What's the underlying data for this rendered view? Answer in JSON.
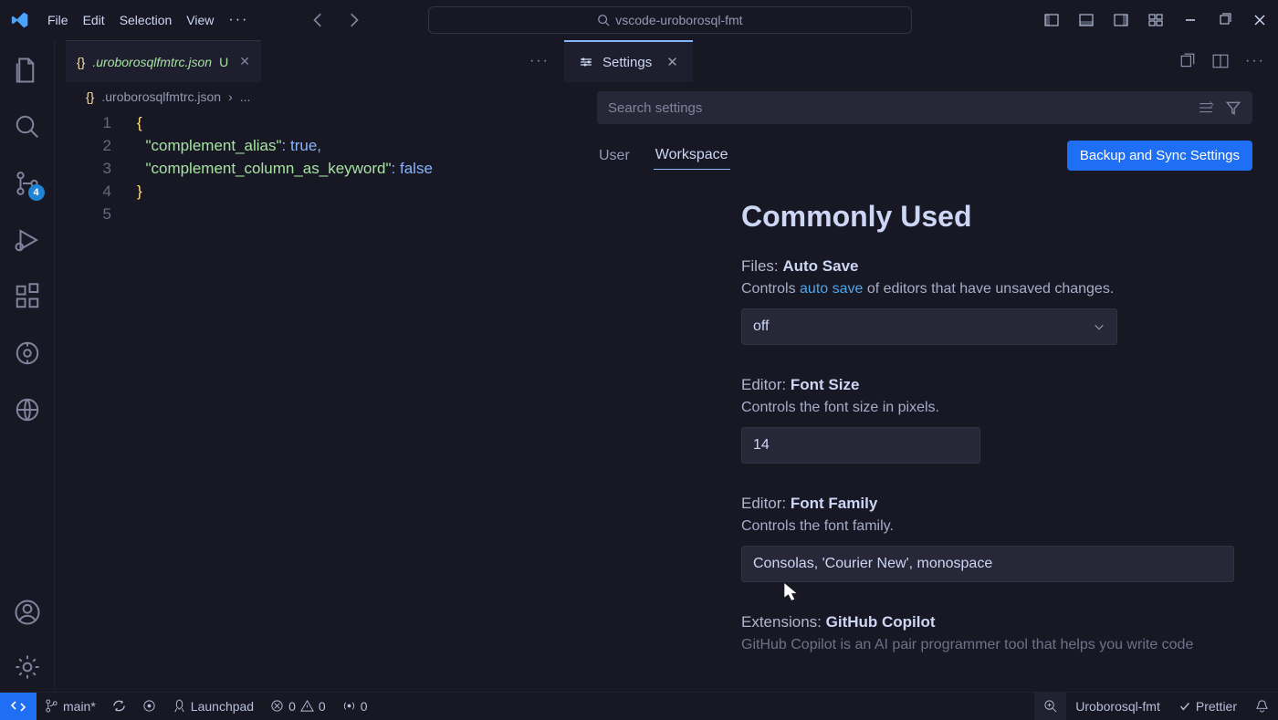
{
  "titlebar": {
    "menu": [
      "File",
      "Edit",
      "Selection",
      "View"
    ],
    "search": "vscode-uroborosql-fmt"
  },
  "activity": {
    "scm_badge": "4"
  },
  "editor_left": {
    "tab": {
      "filename": ".uroborosqlfmtrc.json",
      "dirty": "U"
    },
    "breadcrumb": ".uroborosqlfmtrc.json",
    "breadcrumb_tail": "...",
    "code": {
      "l1": "{",
      "l2_key": "\"complement_alias\"",
      "l2_val": "true",
      "l3_key": "\"complement_column_as_keyword\"",
      "l3_val": "false",
      "l4": "}"
    },
    "line_nums": [
      "1",
      "2",
      "3",
      "4",
      "5"
    ]
  },
  "settings": {
    "tab_label": "Settings",
    "search_placeholder": "Search settings",
    "scopes": {
      "user": "User",
      "workspace": "Workspace"
    },
    "sync_button": "Backup and Sync Settings",
    "section": "Commonly Used",
    "items": [
      {
        "cat": "Files:",
        "name": "Auto Save",
        "desc_pre": "Controls ",
        "desc_link": "auto save",
        "desc_post": " of editors that have unsaved changes.",
        "value": "off",
        "type": "select"
      },
      {
        "cat": "Editor:",
        "name": "Font Size",
        "desc": "Controls the font size in pixels.",
        "value": "14",
        "type": "input-sm"
      },
      {
        "cat": "Editor:",
        "name": "Font Family",
        "desc": "Controls the font family.",
        "value": "Consolas, 'Courier New', monospace",
        "type": "input-lg"
      },
      {
        "cat": "Extensions:",
        "name": "GitHub Copilot",
        "desc": "GitHub Copilot is an AI pair programmer tool that helps you write code",
        "type": "none"
      }
    ]
  },
  "status": {
    "branch": "main*",
    "launchpad": "Launchpad",
    "errors": "0",
    "warns": "0",
    "ports": "0",
    "right": {
      "fmt": "Uroborosql-fmt",
      "prettier": "Prettier"
    }
  }
}
